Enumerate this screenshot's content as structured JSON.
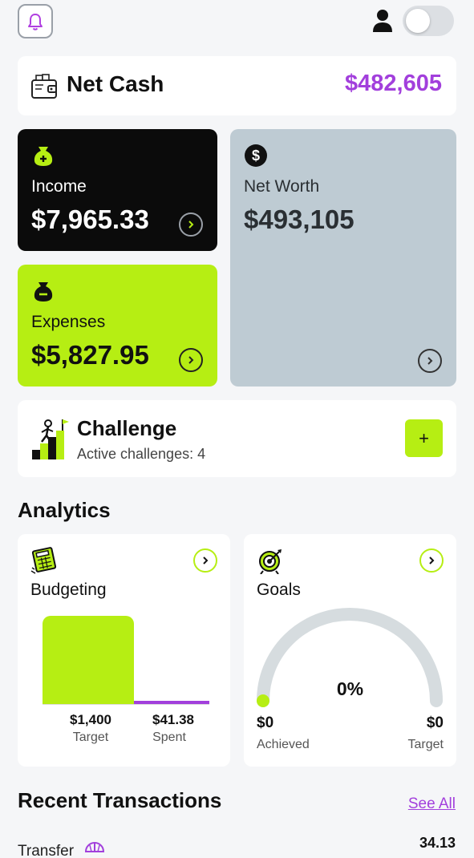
{
  "header": {
    "bell_icon": "bell-icon",
    "profile_icon": "user-icon",
    "theme_toggle": "off"
  },
  "net_cash": {
    "label": "Net Cash",
    "value": "$482,605",
    "icon": "wallet-icon"
  },
  "income": {
    "label": "Income",
    "value": "$7,965.33",
    "icon": "money-bag-plus-icon"
  },
  "expenses": {
    "label": "Expenses",
    "value": "$5,827.95",
    "icon": "money-bag-minus-icon"
  },
  "net_worth": {
    "label": "Net Worth",
    "value": "$493,105",
    "icon": "dollar-coin-icon"
  },
  "challenge": {
    "title": "Challenge",
    "subtitle": "Active challenges: 4",
    "add_label": "+"
  },
  "analytics": {
    "title": "Analytics",
    "budgeting": {
      "label": "Budgeting",
      "target_value": "$1,400",
      "target_label": "Target",
      "spent_value": "$41.38",
      "spent_label": "Spent"
    },
    "goals": {
      "label": "Goals",
      "percent": "0%",
      "progress": 0,
      "achieved_value": "$0",
      "achieved_label": "Achieved",
      "target_value": "$0",
      "target_label": "Target"
    }
  },
  "recent_transactions": {
    "title": "Recent Transactions",
    "see_all": "See All",
    "items": [
      {
        "name": "Transfer",
        "amount": "34.13"
      }
    ]
  },
  "colors": {
    "accent_green": "#b6ee13",
    "accent_purple": "#a23fdc",
    "income_bg": "#0b0b0b",
    "networth_bg": "#becbd3"
  }
}
